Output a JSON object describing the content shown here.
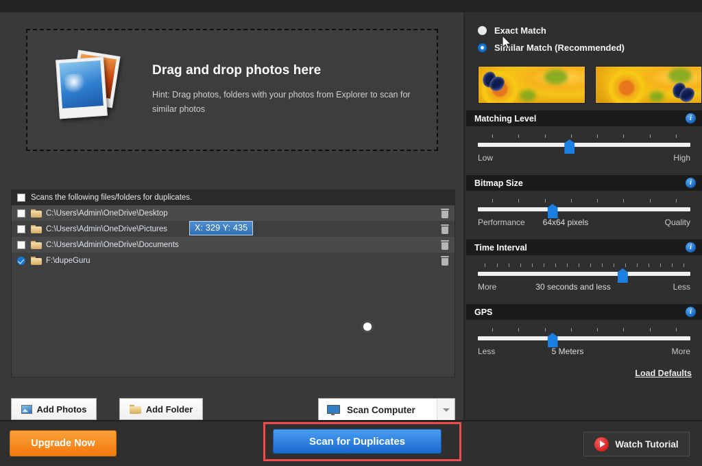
{
  "dropzone": {
    "title": "Drag and drop photos here",
    "hint": "Hint: Drag photos, folders with your photos from Explorer to scan for similar photos",
    "icon": "photos-stack-icon"
  },
  "filelist": {
    "header_label": "Scans the following files/folders for duplicates.",
    "rows": [
      {
        "path": "C:\\Users\\Admin\\OneDrive\\Desktop",
        "checked": false
      },
      {
        "path": "C:\\Users\\Admin\\OneDrive\\Pictures",
        "checked": false
      },
      {
        "path": "C:\\Users\\Admin\\OneDrive\\Documents",
        "checked": false
      },
      {
        "path": "F:\\dupeGuru",
        "checked": true
      }
    ]
  },
  "tooltip": {
    "text": "X: 329 Y: 435"
  },
  "left_actions": {
    "add_photos": "Add Photos",
    "add_folder": "Add Folder",
    "scan_target": "Scan Computer"
  },
  "match_mode": {
    "exact_label": "Exact Match",
    "similar_label": "Similar Match (Recommended)",
    "selected": "similar"
  },
  "preview": {
    "thumb_left": "sunflower-butterfly-left-thumbnail",
    "thumb_right": "sunflower-butterfly-right-thumbnail"
  },
  "settings": [
    {
      "title": "Matching Level",
      "left_label": "Low",
      "right_label": "High",
      "mid_label": "",
      "ticks": 8,
      "value_pct": 43
    },
    {
      "title": "Bitmap Size",
      "left_label": "Performance",
      "right_label": "Quality",
      "mid_label": "64x64 pixels",
      "ticks": 8,
      "value_pct": 35
    },
    {
      "title": "Time Interval",
      "left_label": "More",
      "right_label": "Less",
      "mid_label": "30 seconds and less",
      "ticks": 18,
      "value_pct": 68
    },
    {
      "title": "GPS",
      "left_label": "Less",
      "right_label": "More",
      "mid_label": "5 Meters",
      "ticks": 8,
      "value_pct": 35
    }
  ],
  "load_defaults": "Load Defaults",
  "bottom": {
    "upgrade": "Upgrade Now",
    "scan": "Scan for Duplicates",
    "tutorial": "Watch Tutorial"
  },
  "colors": {
    "accent_blue": "#1a7fe0",
    "upgrade_orange": "#f2790d",
    "highlight_red": "#f04a4a",
    "panel_dark": "#2f2f2f",
    "panel_left": "#3a3a3a"
  }
}
